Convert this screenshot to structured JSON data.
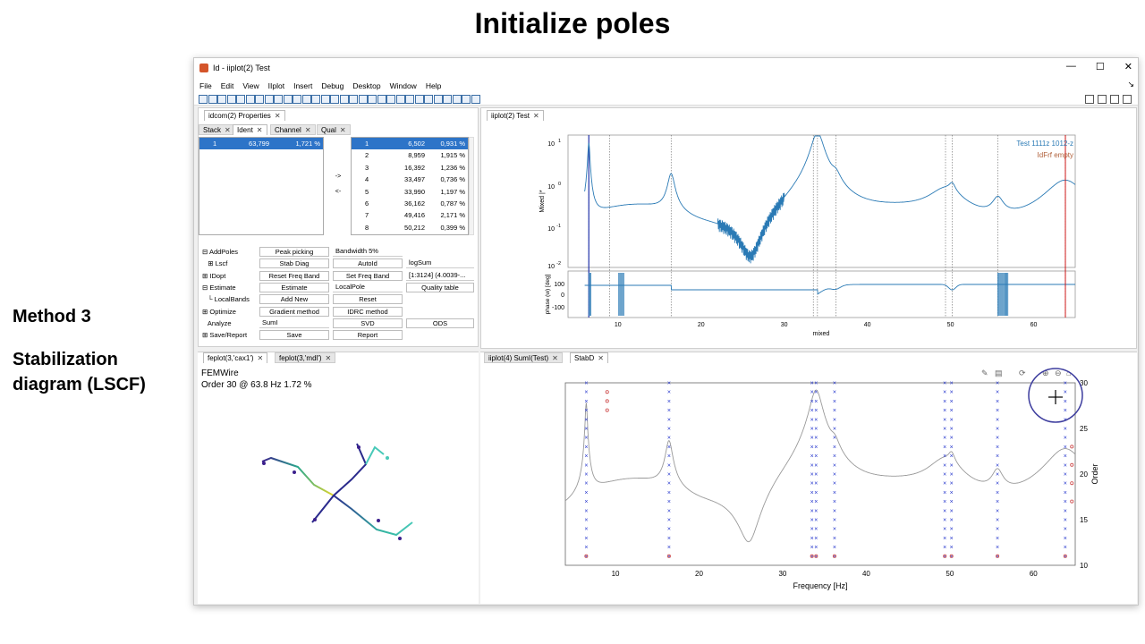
{
  "slide": {
    "title": "Initialize poles",
    "method": "Method 3",
    "stab_title": "Stabilization diagram (LSCF)"
  },
  "window": {
    "title": "Id - iiplot(2) Test",
    "controls": [
      "—",
      "☐",
      "✕"
    ],
    "menus": [
      "File",
      "Edit",
      "View",
      "IIplot",
      "Insert",
      "Debug",
      "Desktop",
      "Window",
      "Help"
    ],
    "corner_mark": "↘"
  },
  "props": {
    "title_tab": "idcom(2) Properties",
    "tabs": [
      "Stack",
      "Ident",
      "Channel",
      "Qual"
    ],
    "left_list": [
      {
        "idx": "1",
        "freq": "63,799",
        "damp": "1,721 %"
      }
    ],
    "right_list": [
      {
        "idx": "1",
        "freq": "6,502",
        "damp": "0,931 %"
      },
      {
        "idx": "2",
        "freq": "8,959",
        "damp": "1,915 %"
      },
      {
        "idx": "3",
        "freq": "16,392",
        "damp": "1,236 %"
      },
      {
        "idx": "4",
        "freq": "33,497",
        "damp": "0,736 %"
      },
      {
        "idx": "5",
        "freq": "33,990",
        "damp": "1,197 %"
      },
      {
        "idx": "6",
        "freq": "36,162",
        "damp": "0,787 %"
      },
      {
        "idx": "7",
        "freq": "49,416",
        "damp": "2,171 %"
      },
      {
        "idx": "8",
        "freq": "50,212",
        "damp": "0,399 %"
      }
    ],
    "move_right": "->",
    "move_left": "<-",
    "grid": [
      {
        "label": "⊟ AddPoles",
        "b1": "Peak picking",
        "b2": "Bandwidth 5%",
        "b2_dropdown": true,
        "b3": ""
      },
      {
        "label": "   ⊞ Lscf",
        "b1": "Stab Diag",
        "b2": "AutoId",
        "b2_dropdown": false,
        "b3": "logSum"
      },
      {
        "label": "⊞ IDopt",
        "b1": "Reset Freq Band",
        "b2": "Set Freq Band",
        "b2_dropdown": false,
        "b3": "[1:3124] (4.0039-..."
      },
      {
        "label": "⊟ Estimate",
        "b1": "Estimate",
        "b2": "LocalPole",
        "b2_dropdown": true,
        "b3": "Quality table"
      },
      {
        "label": "   └ LocalBands",
        "b1": "Add New",
        "b2": "Reset",
        "b2_dropdown": false,
        "b3": ""
      },
      {
        "label": "⊞ Optimize",
        "b1": "Gradient method",
        "b2": "IDRC method",
        "b2_dropdown": false,
        "b3": ""
      },
      {
        "label": "   Analyze",
        "b1": "SumI",
        "b2": "SVD",
        "b2_dropdown": false,
        "b3": "ODS"
      },
      {
        "label": "⊞ Save/Report",
        "b1": "Save",
        "b2": "Report",
        "b2_dropdown": false,
        "b3": ""
      }
    ]
  },
  "iiplot": {
    "tab": "iiplot(2) Test",
    "legend": [
      "Test 1111z 1012-z",
      "IdFrf empty"
    ],
    "ylabel_top": "Mixed |*",
    "ylabel_bottom": "phase (w) [deg]",
    "xlabel": "mixed",
    "xticks": [
      "10",
      "20",
      "30",
      "40",
      "50",
      "60"
    ],
    "yticks_top": [
      "10",
      "10",
      "10",
      "10"
    ],
    "yticks_top_exp": [
      "1",
      "0",
      "-1",
      "-2"
    ],
    "yticks_bottom": [
      "100",
      "0",
      "-100"
    ]
  },
  "feplot": {
    "tabs": [
      "feplot(3,'cax1')",
      "feplot(3,'mdl')"
    ],
    "line1": "FEMWire",
    "line2": "Order 30 @ 63.8 Hz 1.72 %"
  },
  "stab": {
    "tabs": [
      "iiplot(4) SumI(Test)",
      "StabD"
    ],
    "xlabel": "Frequency [Hz]",
    "ylabel": "Order",
    "xticks": [
      "10",
      "20",
      "30",
      "40",
      "50",
      "60"
    ],
    "yticks": [
      "10",
      "15",
      "20",
      "25",
      "30"
    ],
    "pole_columns": [
      6.5,
      16.4,
      33.5,
      34.0,
      36.2,
      49.4,
      50.2,
      55.7,
      63.8
    ]
  },
  "colors": {
    "selection": "#2d74c8",
    "curve": "#2a7ab5",
    "cursor": "#cc0000",
    "stab_x": "#2233cc"
  }
}
